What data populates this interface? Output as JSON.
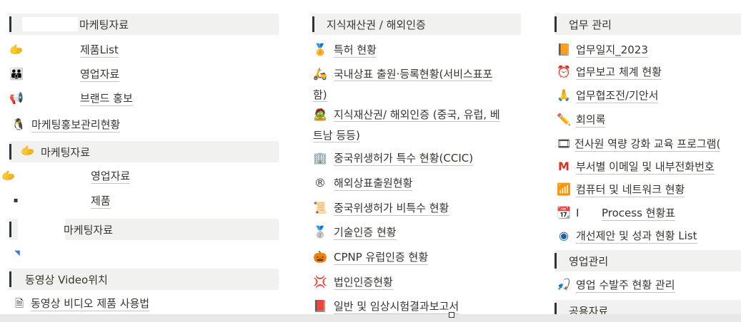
{
  "col1": {
    "header1": "마케팅자료",
    "items1": [
      "제품List",
      "영업자료",
      "브랜드 홍보"
    ],
    "item_promo": "마케팅홍보관리현황",
    "header2": "마케팅자료",
    "items2": [
      "영업자료",
      "제품"
    ],
    "header3": "마케팅자료",
    "header4": "동영상 Video위치",
    "item_video": "동영상 비디오 제품 사용법"
  },
  "col2": {
    "header": "지식재산권 / 해외인증",
    "items": [
      "특허 현황",
      "국내상표 출원·등록현황(서비스표포함)",
      "지식재산권/ 해외인증 (중국, 유럽, 베트남 등등)",
      "중국위생허가 특수 현황(CCIC)",
      "해외상표출원현황",
      "중국위생허가 비특수 현황",
      "기술인증 현황",
      "CPNP 유럽인증 현황",
      "법인인증현황",
      "일반 및 임상시험결과보고서"
    ],
    "wrap_parts": {
      "a1": "국내상표 출원·등록현황(서비스표포",
      "a2": "함)",
      "b1": "지식재산권/ 해외인증 (중국, 유럽, 베",
      "b2": "트남 등등)"
    }
  },
  "col3": {
    "header1": "업무 관리",
    "items1": [
      "업무일지_2023",
      "업무보고 체계 현황",
      "업무협조전/기안서",
      "회의록",
      "전사원 역량 강화 교육 프로그램(",
      "부서별 이메일 및 내부전화번호",
      "컴퓨터 및 네트워크 현황",
      "Process 현황표",
      "개선제안 및 성과 현황 List"
    ],
    "process_prefix": "I",
    "header2": "영업관리",
    "items2": [
      "영업 수발주 현황 관리"
    ],
    "header3": "공용자료"
  },
  "icons": {
    "hand": "pointing-hand-icon",
    "people": "people-icon",
    "megaphone": "megaphone-icon",
    "penguin": "penguin-icon",
    "medal": "medal-icon",
    "scooter": "scooter-icon",
    "zombie": "zombie-icon",
    "building": "building-icon",
    "registered": "registered-icon",
    "scroll": "scroll-icon",
    "medal2": "second-place-medal-icon",
    "pumpkin": "pumpkin-icon",
    "anger": "anger-icon",
    "book": "book-icon",
    "notebook": "notebook-icon",
    "clock": "alarm-clock-icon",
    "pray": "folded-hands-icon",
    "pencil": "pencil-icon",
    "film": "film-icon",
    "gmail": "gmail-icon",
    "wifi": "wifi-icon",
    "calendar": "calendar-icon",
    "target": "target-icon",
    "fishing": "fishing-icon",
    "document": "document-icon"
  }
}
